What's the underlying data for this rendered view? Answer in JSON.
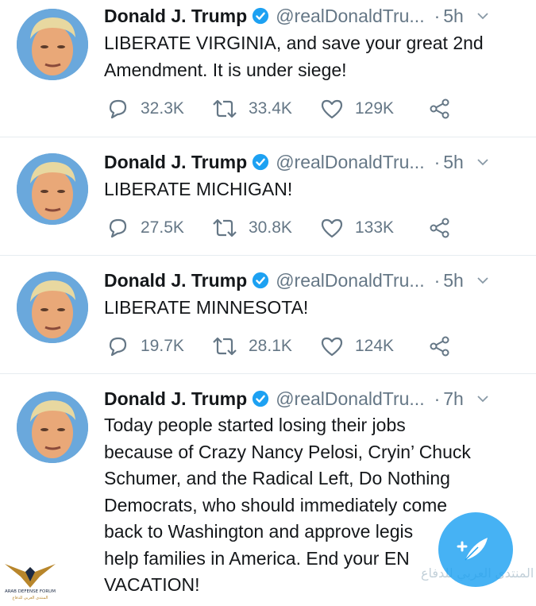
{
  "tweets": [
    {
      "name": "Donald J. Trump",
      "handle": "@realDonaldTru...",
      "dot": "·",
      "time": "5h",
      "text": "LIBERATE VIRGINIA, and save your great 2nd Amendment. It is under siege!",
      "replies": "32.3K",
      "retweets": "33.4K",
      "likes": "129K"
    },
    {
      "name": "Donald J. Trump",
      "handle": "@realDonaldTru...",
      "dot": "·",
      "time": "5h",
      "text": "LIBERATE MICHIGAN!",
      "replies": "27.5K",
      "retweets": "30.8K",
      "likes": "133K"
    },
    {
      "name": "Donald J. Trump",
      "handle": "@realDonaldTru...",
      "dot": "·",
      "time": "5h",
      "text": "LIBERATE MINNESOTA!",
      "replies": "19.7K",
      "retweets": "28.1K",
      "likes": "124K"
    },
    {
      "name": "Donald J. Trump",
      "handle": "@realDonaldTru...",
      "dot": "·",
      "time": "7h",
      "text_lines": [
        "Today people started losing their jobs",
        "because of Crazy Nancy Pelosi, Cryin’ Chuck",
        "Schumer, and the Radical Left, Do Nothing",
        "Democrats, who should immediately come",
        "back to Washington and approve legis",
        "help families in America. End your EN",
        "VACATION!"
      ]
    }
  ],
  "watermark": {
    "arabic_text": "المنتدى العربي للدفاع",
    "forum_logo_text": "ARAB DEFENSE FORUM"
  },
  "colors": {
    "verified": "#1da1f2",
    "fab": "#1da1f2",
    "icon_gray": "#657786",
    "text": "#14171a"
  },
  "icons": {
    "reply": "reply-icon",
    "retweet": "retweet-icon",
    "like": "heart-icon",
    "share": "share-icon",
    "verified": "verified-badge-icon",
    "caret": "chevron-down-icon",
    "compose": "compose-feather-icon"
  }
}
